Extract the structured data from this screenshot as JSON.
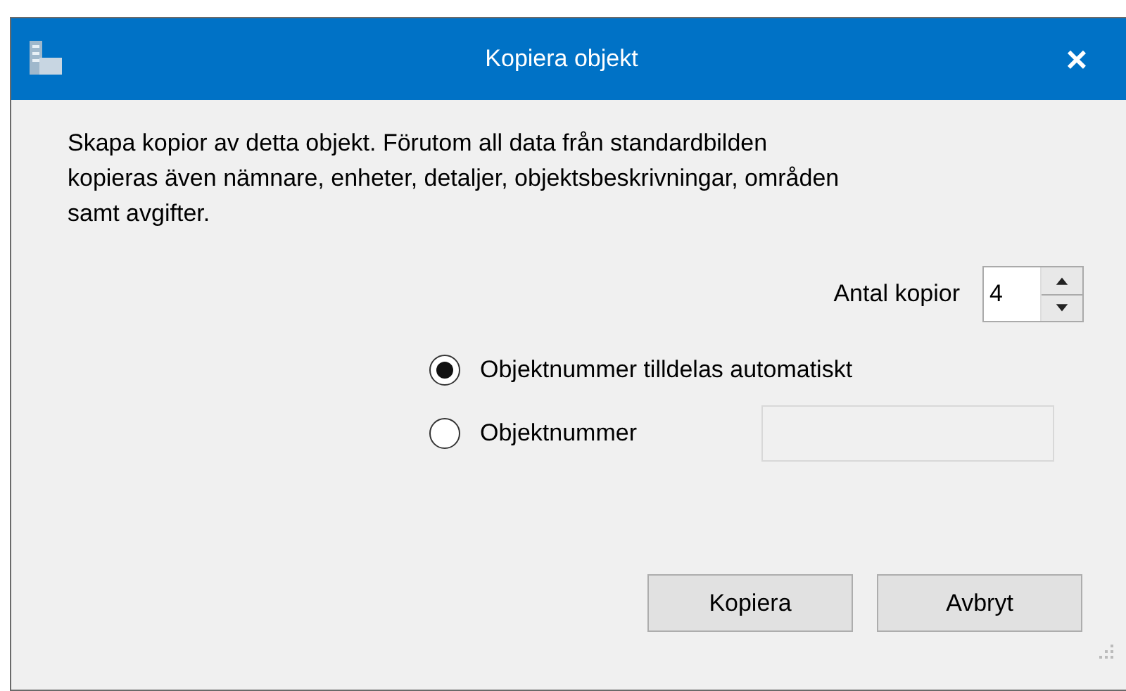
{
  "window": {
    "title": "Kopiera objekt",
    "close": "×"
  },
  "description": "Skapa kopior av detta objekt. Förutom all data från standardbilden kopieras även nämnare, enheter, detaljer, objektsbeskrivningar, områden samt avgifter.",
  "copies": {
    "label": "Antal kopior",
    "value": "4"
  },
  "options": [
    {
      "kind": "plain",
      "label": "Objektnummer tilldelas automatiskt",
      "selected": true
    },
    {
      "kind": "with_field",
      "label": "Objektnummer",
      "selected": false,
      "field_disabled": true
    }
  ],
  "buttons": [
    "Kopiera",
    "Avbryt"
  ]
}
